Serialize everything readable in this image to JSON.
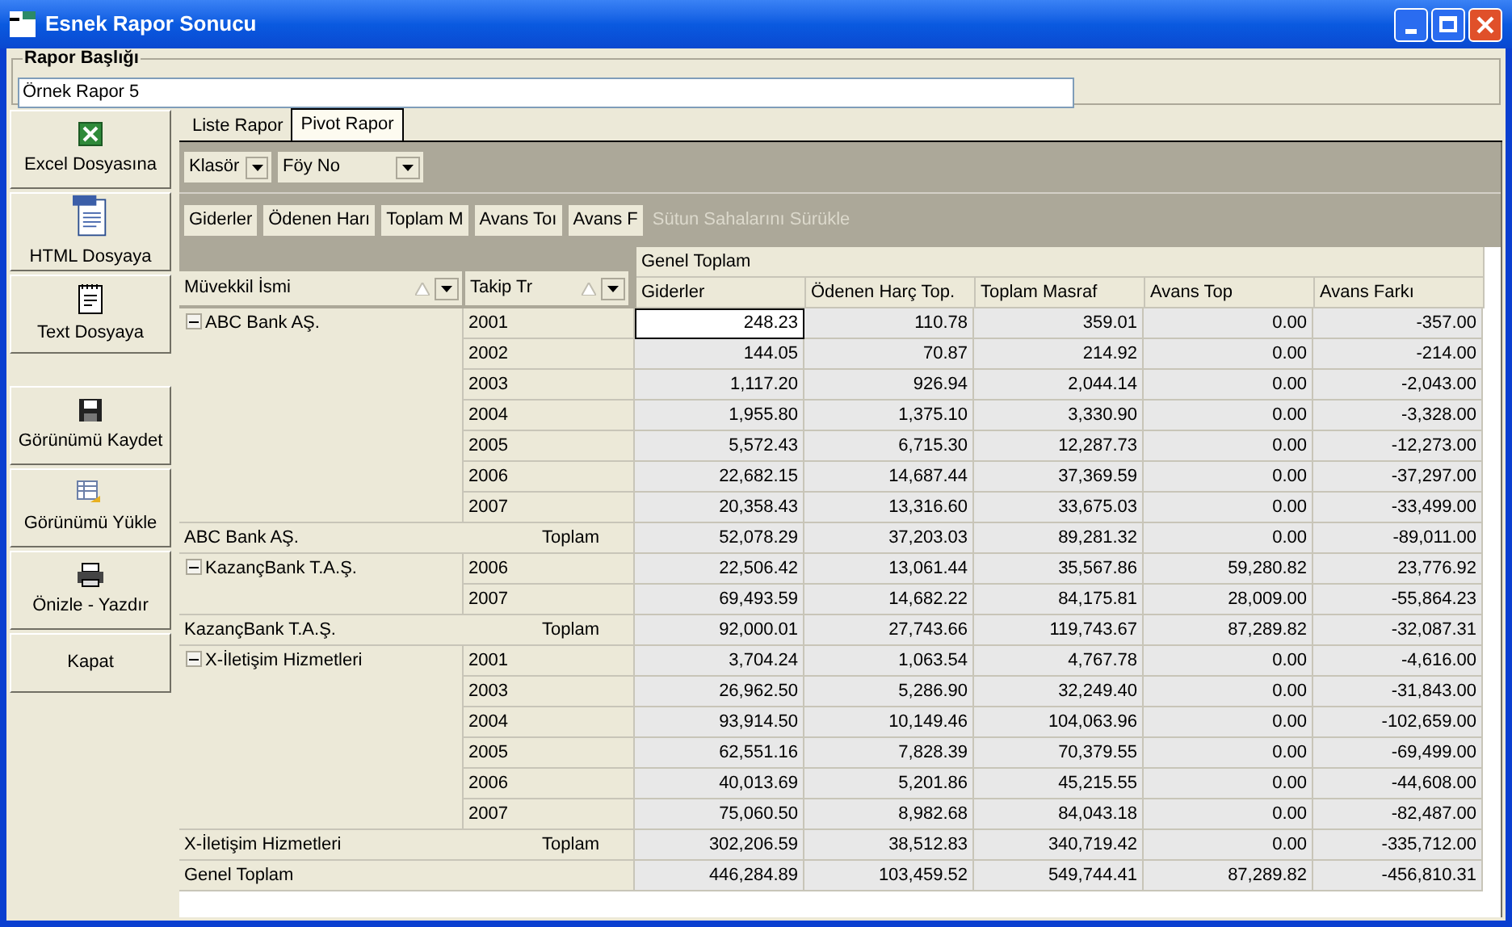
{
  "window": {
    "title": "Esnek Rapor Sonucu"
  },
  "report_title": {
    "label": "Rapor Başlığı",
    "value": "Örnek Rapor 5"
  },
  "sidebar": [
    "Excel Dosyasına",
    "HTML Dosyaya",
    "Text Dosyaya",
    "Görünümü Kaydet",
    "Görünümü Yükle",
    "Önizle - Yazdır",
    "Kapat"
  ],
  "tabs": [
    {
      "label": "Liste Rapor",
      "selected": false
    },
    {
      "label": "Pivot Rapor",
      "selected": true
    }
  ],
  "filter_fields": [
    "Klasör",
    "Föy No"
  ],
  "data_fields": [
    "Giderler",
    "Ödenen Harı",
    "Toplam M",
    "Avans Toı",
    "Avans F"
  ],
  "column_hint": "Sütun Sahalarını Sürükle",
  "row_fields": [
    "Müvekkil İsmi",
    "Takip Tr"
  ],
  "grid": {
    "column_group": "Genel Toplam",
    "columns": [
      "Giderler",
      "Ödenen Harç Top.",
      "Toplam Masraf",
      "Avans Top",
      "Avans Farkı"
    ],
    "groups": [
      {
        "name": "ABC Bank AŞ.",
        "expanded": true,
        "rows": [
          {
            "year": "2001",
            "values": [
              "248.23",
              "110.78",
              "359.01",
              "0.00",
              "-357.00"
            ],
            "selected": true
          },
          {
            "year": "2002",
            "values": [
              "144.05",
              "70.87",
              "214.92",
              "0.00",
              "-214.00"
            ],
            "selected": false
          },
          {
            "year": "2003",
            "values": [
              "1,117.20",
              "926.94",
              "2,044.14",
              "0.00",
              "-2,043.00"
            ],
            "selected": false
          },
          {
            "year": "2004",
            "values": [
              "1,955.80",
              "1,375.10",
              "3,330.90",
              "0.00",
              "-3,328.00"
            ],
            "selected": false
          },
          {
            "year": "2005",
            "values": [
              "5,572.43",
              "6,715.30",
              "12,287.73",
              "0.00",
              "-12,273.00"
            ],
            "selected": false
          },
          {
            "year": "2006",
            "values": [
              "22,682.15",
              "14,687.44",
              "37,369.59",
              "0.00",
              "-37,297.00"
            ],
            "selected": false
          },
          {
            "year": "2007",
            "values": [
              "20,358.43",
              "13,316.60",
              "33,675.03",
              "0.00",
              "-33,499.00"
            ],
            "selected": false
          }
        ],
        "total_name": "ABC Bank AŞ.",
        "total_label": "Toplam",
        "total_values": [
          "52,078.29",
          "37,203.03",
          "89,281.32",
          "0.00",
          "-89,011.00"
        ]
      },
      {
        "name": "KazançBank T.A.Ş.",
        "expanded": true,
        "rows": [
          {
            "year": "2006",
            "values": [
              "22,506.42",
              "13,061.44",
              "35,567.86",
              "59,280.82",
              "23,776.92"
            ],
            "selected": false
          },
          {
            "year": "2007",
            "values": [
              "69,493.59",
              "14,682.22",
              "84,175.81",
              "28,009.00",
              "-55,864.23"
            ],
            "selected": false
          }
        ],
        "total_name": "KazançBank T.A.Ş.",
        "total_label": "Toplam",
        "total_values": [
          "92,000.01",
          "27,743.66",
          "119,743.67",
          "87,289.82",
          "-32,087.31"
        ]
      },
      {
        "name": "X-İletişim Hizmetleri",
        "expanded": true,
        "rows": [
          {
            "year": "2001",
            "values": [
              "3,704.24",
              "1,063.54",
              "4,767.78",
              "0.00",
              "-4,616.00"
            ],
            "selected": false
          },
          {
            "year": "2003",
            "values": [
              "26,962.50",
              "5,286.90",
              "32,249.40",
              "0.00",
              "-31,843.00"
            ],
            "selected": false
          },
          {
            "year": "2004",
            "values": [
              "93,914.50",
              "10,149.46",
              "104,063.96",
              "0.00",
              "-102,659.00"
            ],
            "selected": false
          },
          {
            "year": "2005",
            "values": [
              "62,551.16",
              "7,828.39",
              "70,379.55",
              "0.00",
              "-69,499.00"
            ],
            "selected": false
          },
          {
            "year": "2006",
            "values": [
              "40,013.69",
              "5,201.86",
              "45,215.55",
              "0.00",
              "-44,608.00"
            ],
            "selected": false
          },
          {
            "year": "2007",
            "values": [
              "75,060.50",
              "8,982.68",
              "84,043.18",
              "0.00",
              "-82,487.00"
            ],
            "selected": false
          }
        ],
        "total_name": "X-İletişim Hizmetleri",
        "total_label": "Toplam",
        "total_values": [
          "302,206.59",
          "38,512.83",
          "340,719.42",
          "0.00",
          "-335,712.00"
        ]
      }
    ],
    "grand_total": {
      "label": "Genel Toplam",
      "values": [
        "446,284.89",
        "103,459.52",
        "549,744.41",
        "87,289.82",
        "-456,810.31"
      ]
    }
  }
}
